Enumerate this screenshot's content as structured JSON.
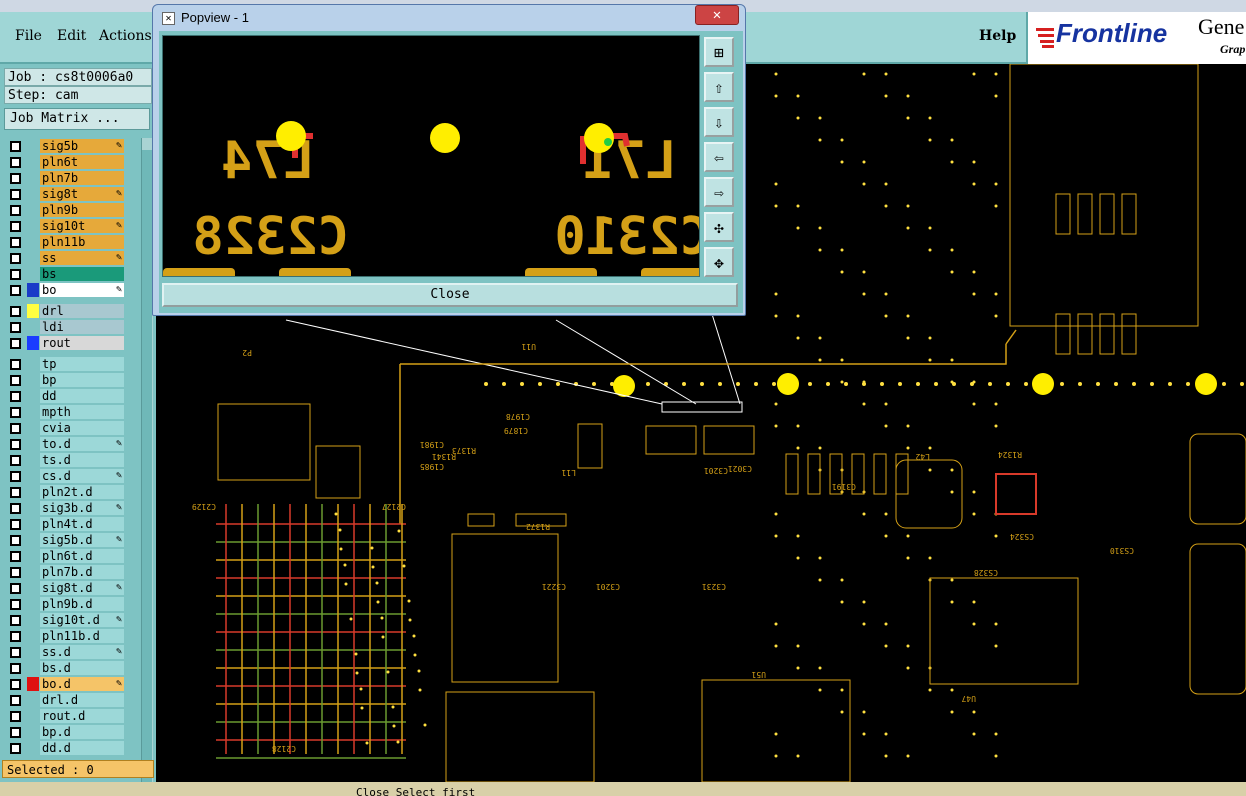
{
  "menu": {
    "file": "File",
    "edit": "Edit",
    "actions": "Actions",
    "help": "Help"
  },
  "logo": {
    "brand": "Frontline",
    "gene": "Gene",
    "grap": "Grap"
  },
  "job": {
    "label": "Job : cs8t0006a0",
    "step": "Step: cam"
  },
  "job_matrix_button": "Job Matrix ...",
  "layers_group1": [
    {
      "name": "sig5b",
      "color": "#e6a93a",
      "icon": "pencil-icon"
    },
    {
      "name": "pln6t",
      "color": "#e6a93a",
      "icon": ""
    },
    {
      "name": "pln7b",
      "color": "#e6a93a",
      "icon": ""
    },
    {
      "name": "sig8t",
      "color": "#e6a93a",
      "icon": "pencil-icon"
    },
    {
      "name": "pln9b",
      "color": "#e6a93a",
      "icon": ""
    },
    {
      "name": "sig10t",
      "color": "#e6a93a",
      "icon": "pencil-icon"
    },
    {
      "name": "pln11b",
      "color": "#e6a93a",
      "icon": ""
    },
    {
      "name": "ss",
      "color": "#e6a93a",
      "icon": "pencil-icon"
    },
    {
      "name": "bs",
      "color": "#1a9a7a",
      "icon": ""
    },
    {
      "name": "bo",
      "color": "#ffffff",
      "icon": "pencil-icon",
      "swatch": "#1a3cc8",
      "swatch2": "#2e9a2e"
    }
  ],
  "layers_group2": [
    {
      "name": "drl",
      "color": "#a8c8d0",
      "swatch": "#ffff40"
    },
    {
      "name": "ldi",
      "color": "#a8c8d0"
    },
    {
      "name": "rout",
      "color": "#d8d8d8",
      "swatch": "#1a3cff"
    }
  ],
  "layers_group3": [
    {
      "name": "tp"
    },
    {
      "name": "bp"
    },
    {
      "name": "dd"
    },
    {
      "name": "mpth"
    },
    {
      "name": "cvia"
    },
    {
      "name": "to.d",
      "icon": "pencil-icon"
    },
    {
      "name": "ts.d"
    },
    {
      "name": "cs.d",
      "icon": "pencil-icon"
    },
    {
      "name": "pln2t.d"
    },
    {
      "name": "sig3b.d",
      "icon": "pencil-icon"
    },
    {
      "name": "pln4t.d"
    },
    {
      "name": "sig5b.d",
      "icon": "pencil-icon"
    },
    {
      "name": "pln6t.d"
    },
    {
      "name": "pln7b.d"
    },
    {
      "name": "sig8t.d",
      "icon": "pencil-icon"
    },
    {
      "name": "pln9b.d"
    },
    {
      "name": "sig10t.d",
      "icon": "pencil-icon"
    },
    {
      "name": "pln11b.d"
    },
    {
      "name": "ss.d",
      "icon": "pencil-icon"
    },
    {
      "name": "bs.d"
    },
    {
      "name": "bo.d",
      "icon": "pencil-icon",
      "swatch": "#e01010",
      "color": "#f5c468"
    },
    {
      "name": "drl.d"
    },
    {
      "name": "rout.d"
    },
    {
      "name": "bp.d"
    },
    {
      "name": "dd.d"
    }
  ],
  "selected": "Selected : 0",
  "popup": {
    "title": "Popview - 1",
    "close_label": "Close",
    "labels": [
      "C2328",
      "C2310",
      "L74",
      "L71"
    ],
    "tools": [
      "zoom-fit-icon",
      "zoom-up-icon",
      "zoom-down-icon",
      "pan-left-icon",
      "pan-right-icon",
      "zoom-out-icon",
      "pan-icon"
    ]
  },
  "board_labels": [
    "CS328",
    "CS324",
    "CS310",
    "U47",
    "L42",
    "U51",
    "R1324",
    "C3021",
    "C3191",
    "C3201",
    "C3221",
    "L11",
    "R1373",
    "C1981",
    "C1985",
    "R1341",
    "C1879",
    "C1978",
    "R1372",
    "C2129",
    "C2127",
    "C2128",
    "U11",
    "P2",
    "C3231",
    "C3201"
  ],
  "status_text": "Close Select first"
}
